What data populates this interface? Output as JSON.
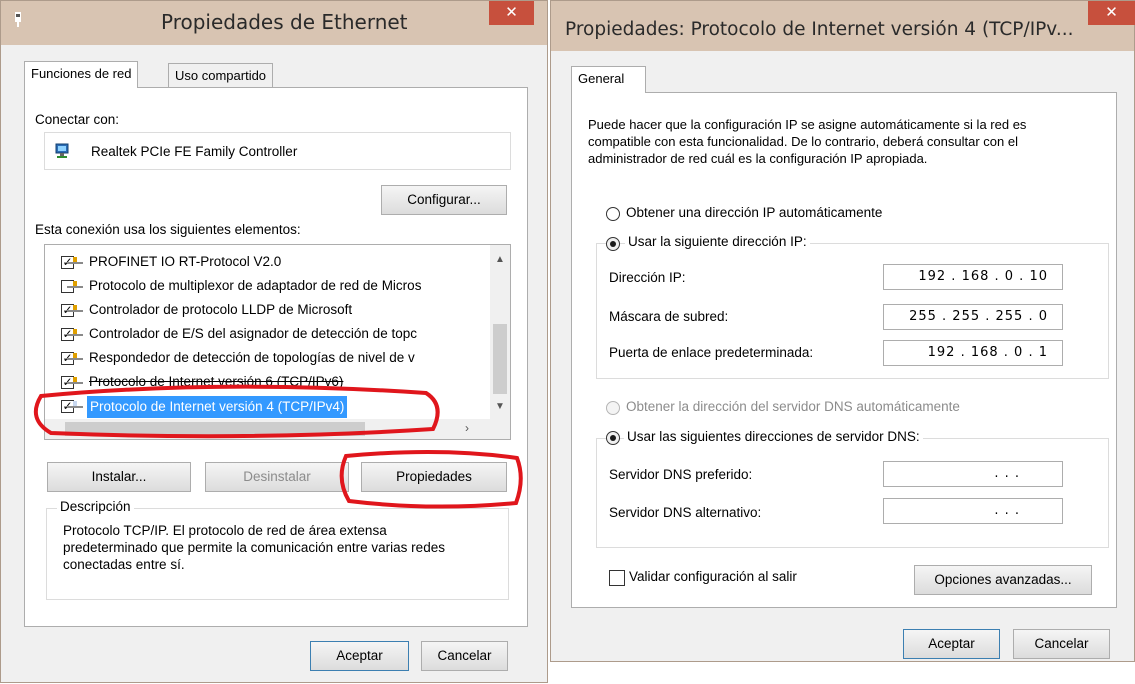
{
  "left": {
    "title": "Propiedades de Ethernet",
    "close": "✕",
    "tabs": [
      "Funciones de red",
      "Uso compartido"
    ],
    "connect_label": "Conectar con:",
    "adapter_name": "Realtek PCIe FE Family Controller",
    "configure_button": "Configurar...",
    "elements_label": "Esta conexión usa los siguientes elementos:",
    "items": [
      {
        "label": "PROFINET IO RT-Protocol V2.0",
        "checked": true
      },
      {
        "label": "Protocolo de multiplexor de adaptador de red de Micros",
        "checked": false
      },
      {
        "label": "Controlador de protocolo LLDP de Microsoft",
        "checked": true
      },
      {
        "label": "Controlador de E/S del asignador de detección de topc",
        "checked": true
      },
      {
        "label": "Respondedor de detección de topologías de nivel de v",
        "checked": true
      },
      {
        "label": "Protocolo de Internet versión 6 (TCP/IPv6)",
        "checked": true
      },
      {
        "label": "Protocolo de Internet versión 4 (TCP/IPv4)",
        "checked": true
      }
    ],
    "install_button": "Instalar...",
    "uninstall_button": "Desinstalar",
    "properties_button": "Propiedades",
    "description_title": "Descripción",
    "description_text": "Protocolo TCP/IP. El protocolo de red de área extensa predeterminado que permite la comunicación entre varias redes conectadas entre sí.",
    "ok_button": "Aceptar",
    "cancel_button": "Cancelar"
  },
  "right": {
    "title": "Propiedades: Protocolo de Internet versión 4 (TCP/IPv...",
    "close": "✕",
    "tab": "General",
    "intro": "Puede hacer que la configuración IP se asigne automáticamente si la red es compatible con esta funcionalidad. De lo contrario, deberá consultar con el administrador de red cuál es la configuración IP apropiada.",
    "radio_auto_ip": "Obtener una dirección IP automáticamente",
    "radio_manual_ip": "Usar la siguiente dirección IP:",
    "ip_label": "Dirección IP:",
    "ip_value": "192 . 168 .  0  . 10",
    "mask_label": "Máscara de subred:",
    "mask_value": "255 . 255 . 255 .  0",
    "gateway_label": "Puerta de enlace predeterminada:",
    "gateway_value": "192 . 168 .  0  .  1",
    "radio_auto_dns": "Obtener la dirección del servidor DNS automáticamente",
    "radio_manual_dns": "Usar las siguientes direcciones de servidor DNS:",
    "dns_pref_label": "Servidor DNS preferido:",
    "dns_pref_value": ".       .       .",
    "dns_alt_label": "Servidor DNS alternativo:",
    "dns_alt_value": ".       .       .",
    "validate_label": "Validar configuración al salir",
    "advanced_button": "Opciones avanzadas...",
    "ok_button": "Aceptar",
    "cancel_button": "Cancelar"
  },
  "colors": {
    "titlebar": "#d8c4b2",
    "close": "#c7503d",
    "selection": "#3399ff",
    "annotation": "#e0161c"
  }
}
